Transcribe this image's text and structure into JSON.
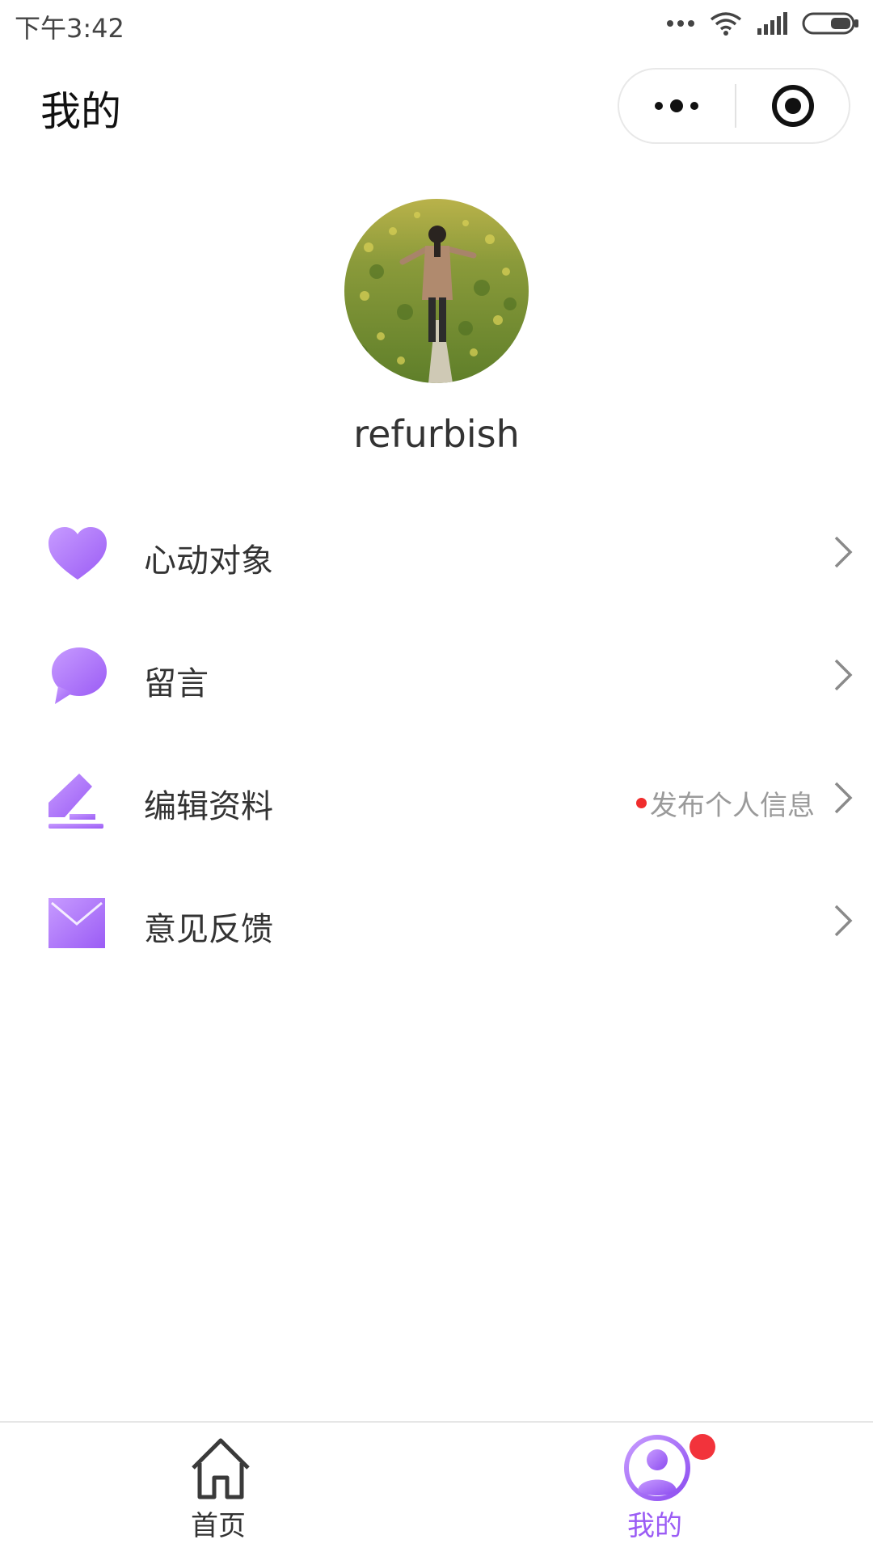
{
  "status_bar": {
    "time": "下午3:42",
    "icons": [
      "more-dots-icon",
      "wifi-icon",
      "signal-icon",
      "battery-icon"
    ]
  },
  "nav": {
    "title": "我的",
    "capsule_icons": [
      "more-icon",
      "close-target-icon"
    ]
  },
  "profile": {
    "username": "refurbish",
    "avatar_icon": "avatar-photo"
  },
  "menu": {
    "items": [
      {
        "label": "心动对象",
        "icon": "heart-icon",
        "hint": ""
      },
      {
        "label": "留言",
        "icon": "chat-bubble-icon",
        "hint": ""
      },
      {
        "label": "编辑资料",
        "icon": "edit-pen-icon",
        "hint": "发布个人信息"
      },
      {
        "label": "意见反馈",
        "icon": "envelope-icon",
        "hint": ""
      }
    ]
  },
  "tab_bar": {
    "tabs": [
      {
        "label": "首页",
        "icon": "home-icon",
        "active": false
      },
      {
        "label": "我的",
        "icon": "user-icon",
        "active": true
      }
    ]
  },
  "colors": {
    "accent": "#9b5cf5",
    "accent_light": "#c9a2ff",
    "badge": "#f2333b",
    "text": "#333333",
    "hint": "#9a9a9a"
  }
}
